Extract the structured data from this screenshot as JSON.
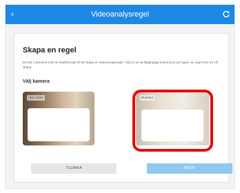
{
  "header": {
    "title": "Videoanalysregel",
    "back_icon": "chevron-left-icon",
    "refresh_icon": "refresh-icon",
    "bar_color": "#1e88e5"
  },
  "main": {
    "heading": "Skapa en regel",
    "description": "Du har 2 kameror som är kvalificerade till att skapa en videoanalysregel. Välj en av de tillgängliga kamerorna och typen av regel som du vill skapa.",
    "subheading": "Välj kamera",
    "cameras": [
      {
        "label": "ADC-V515"
      },
      {
        "label": "Rummet"
      }
    ],
    "highlight_color": "#e50b0b"
  },
  "buttons": {
    "back": "TILLBAKA",
    "next": "NÄSTA",
    "next_color": "#8fc8f0"
  }
}
